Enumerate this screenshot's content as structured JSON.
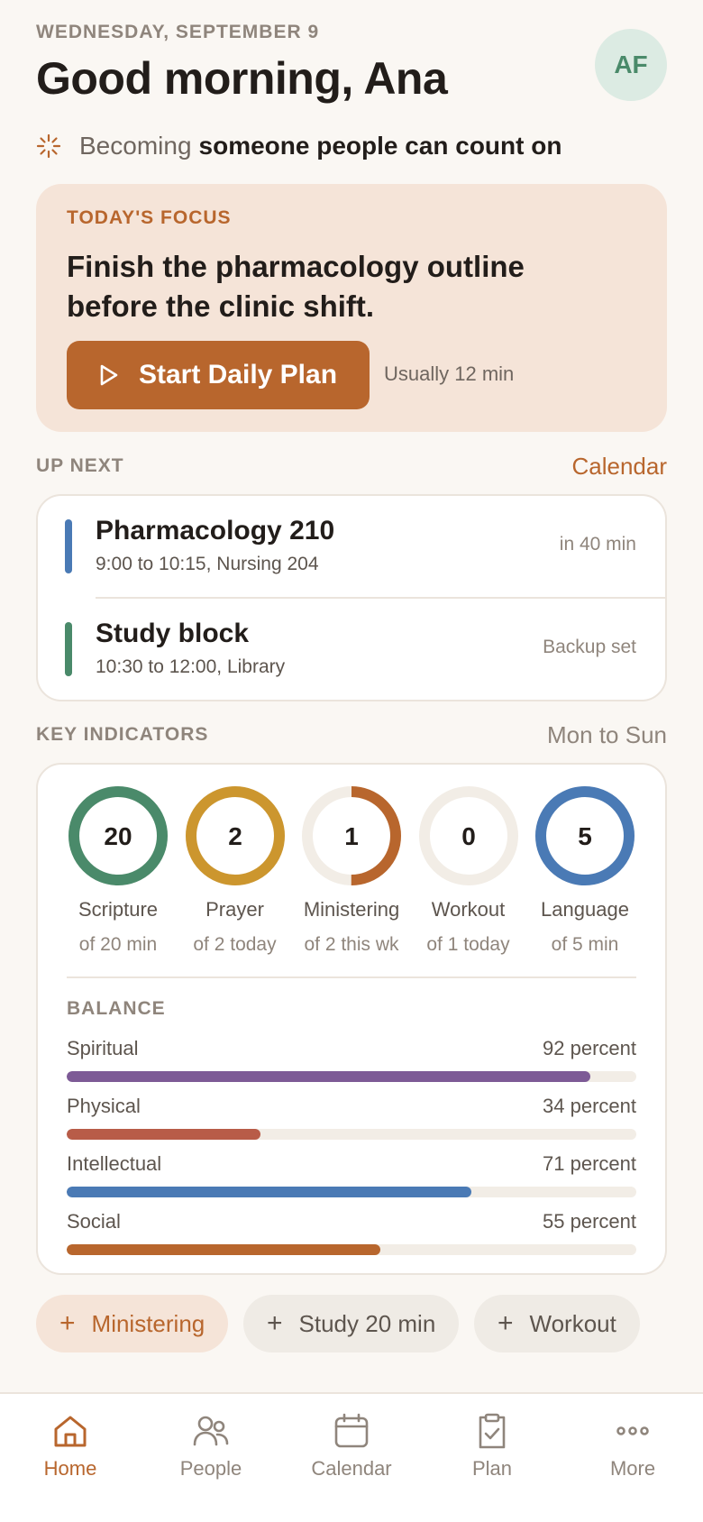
{
  "header": {
    "date": "WEDNESDAY, SEPTEMBER 9",
    "greeting": "Good morning, Ana",
    "avatar_initials": "AF"
  },
  "identity": {
    "prefix": "Becoming",
    "statement": "someone people can count on",
    "icon": "sparkle-icon"
  },
  "focus": {
    "label": "TODAY'S FOCUS",
    "text": "Finish the pharmacology outline before the clinic shift.",
    "button_label": "Start Daily Plan",
    "button_icon": "play-icon",
    "duration": "Usually 12 min"
  },
  "up_next": {
    "label": "UP NEXT",
    "link": "Calendar",
    "events": [
      {
        "title": "Pharmacology 210",
        "subtitle": "9:00 to 10:15, Nursing 204",
        "status": "in 40 min",
        "color": "#4a7ab5"
      },
      {
        "title": "Study block",
        "subtitle": "10:30 to 12:00, Library",
        "status": "Backup set",
        "color": "#4a8a6a"
      }
    ]
  },
  "indicators": {
    "label": "KEY INDICATORS",
    "range": "Mon to Sun",
    "rings": [
      {
        "value": "20",
        "name": "Scripture",
        "target": "of 20 min",
        "progress": 1.0,
        "color": "#4a8a6a"
      },
      {
        "value": "2",
        "name": "Prayer",
        "target": "of 2 today",
        "progress": 1.0,
        "color": "#cc962e"
      },
      {
        "value": "1",
        "name": "Ministering",
        "target": "of 2 this wk",
        "progress": 0.5,
        "color": "#b8662d"
      },
      {
        "value": "0",
        "name": "Workout",
        "target": "of 1 today",
        "progress": 0.0,
        "color": "#b8662d"
      },
      {
        "value": "5",
        "name": "Language",
        "target": "of 5 min",
        "progress": 1.0,
        "color": "#4a7ab5"
      }
    ],
    "balance_label": "BALANCE",
    "balance": [
      {
        "name": "Spiritual",
        "value_text": "92 percent",
        "percent": 92,
        "color": "#7d5a96"
      },
      {
        "name": "Physical",
        "value_text": "34 percent",
        "percent": 34,
        "color": "#b85c48"
      },
      {
        "name": "Intellectual",
        "value_text": "71 percent",
        "percent": 71,
        "color": "#4a7ab5"
      },
      {
        "name": "Social",
        "value_text": "55 percent",
        "percent": 55,
        "color": "#b8662d"
      }
    ]
  },
  "quick_add": [
    {
      "label": "Ministering",
      "active": true
    },
    {
      "label": "Study 20 min",
      "active": false
    },
    {
      "label": "Workout",
      "active": false
    }
  ],
  "tabs": [
    {
      "label": "Home",
      "icon": "home-icon",
      "active": true
    },
    {
      "label": "People",
      "icon": "people-icon",
      "active": false
    },
    {
      "label": "Calendar",
      "icon": "calendar-icon",
      "active": false
    },
    {
      "label": "Plan",
      "icon": "clipboard-check-icon",
      "active": false
    },
    {
      "label": "More",
      "icon": "more-icon",
      "active": false
    }
  ],
  "colors": {
    "accent": "#b8662d",
    "background": "#faf7f3",
    "focus_bg": "#f5e4d8"
  }
}
